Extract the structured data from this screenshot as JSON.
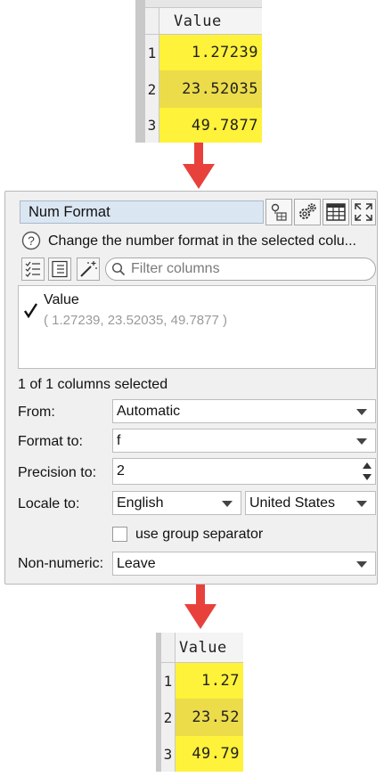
{
  "top_table": {
    "header": "Value",
    "rows": [
      {
        "num": "1",
        "value": "1.27239"
      },
      {
        "num": "2",
        "value": "23.52035"
      },
      {
        "num": "3",
        "value": "49.7877"
      }
    ]
  },
  "panel": {
    "title": "Num Format",
    "help_text": "Change the number format in the selected colu...",
    "filter_placeholder": "Filter columns",
    "column": {
      "name": "Value",
      "preview": "( 1.27239, 23.52035, 49.7877 )",
      "checked": true
    },
    "selection_status": "1 of 1 columns selected",
    "from_label": "From:",
    "from_value": "Automatic",
    "format_label": "Format to:",
    "format_value": "f",
    "precision_label": "Precision to:",
    "precision_value": "2",
    "locale_label": "Locale to:",
    "locale_language": "English",
    "locale_country": "United States",
    "group_separator_label": "use group separator",
    "nonnumeric_label": "Non-numeric:",
    "nonnumeric_value": "Leave"
  },
  "bottom_table": {
    "header": "Value",
    "rows": [
      {
        "num": "1",
        "value": "1.27"
      },
      {
        "num": "2",
        "value": "23.52"
      },
      {
        "num": "3",
        "value": "49.79"
      }
    ]
  },
  "colors": {
    "arrow": "#e8413c",
    "cell_yellow": "#fff23a",
    "cell_yellow_selected": "#ecdc4a",
    "title_bg": "#dbe6f3"
  }
}
